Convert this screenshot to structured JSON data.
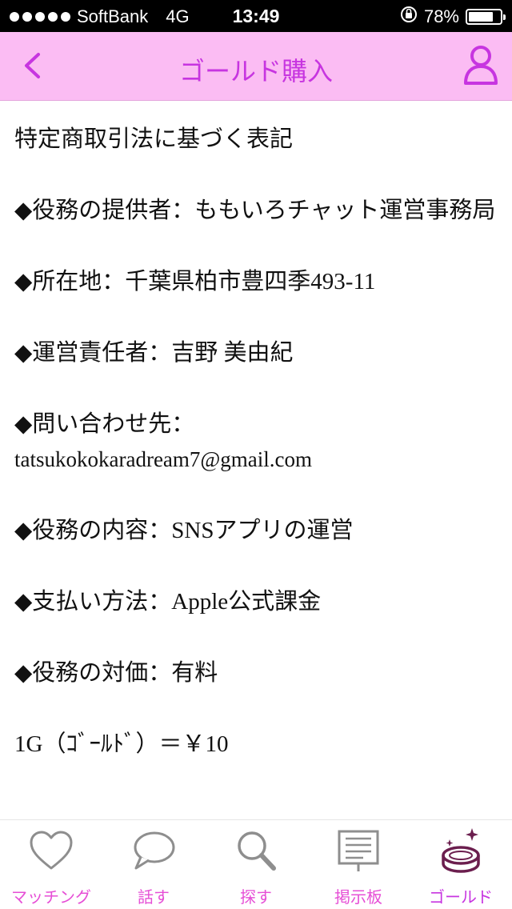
{
  "status_bar": {
    "carrier": "SoftBank",
    "network": "4G",
    "time": "13:49",
    "battery_text": "78%",
    "battery_level": 0.78
  },
  "nav": {
    "title": "ゴールド購入",
    "back_icon": "chevron-left-icon",
    "user_icon": "user-icon"
  },
  "content": {
    "heading": "特定商取引法に基づく表記",
    "provider": "◆役務の提供者：ももいろチャット運営事務局",
    "location": "◆所在地：千葉県柏市豊四季493-11",
    "manager": "◆運営責任者：吉野 美由紀",
    "contact_label": "◆問い合わせ先：",
    "contact_email": "tatsukokokaradream7@gmail.com",
    "service": "◆役務の内容：SNSアプリの運営",
    "payment": "◆支払い方法：Apple公式課金",
    "price": "◆役務の対価：有料",
    "rate": "1G（ｺﾞｰﾙﾄﾞ）＝￥10"
  },
  "tabs": [
    {
      "label": "マッチング",
      "icon": "heart-icon"
    },
    {
      "label": "話す",
      "icon": "chat-bubble-icon"
    },
    {
      "label": "探す",
      "icon": "search-icon"
    },
    {
      "label": "掲示板",
      "icon": "bulletin-board-icon"
    },
    {
      "label": "ゴールド",
      "icon": "gold-coin-icon"
    }
  ],
  "colors": {
    "nav_background": "#fbbcf3",
    "accent": "#c735e0",
    "tab_label": "#e64fd6"
  }
}
